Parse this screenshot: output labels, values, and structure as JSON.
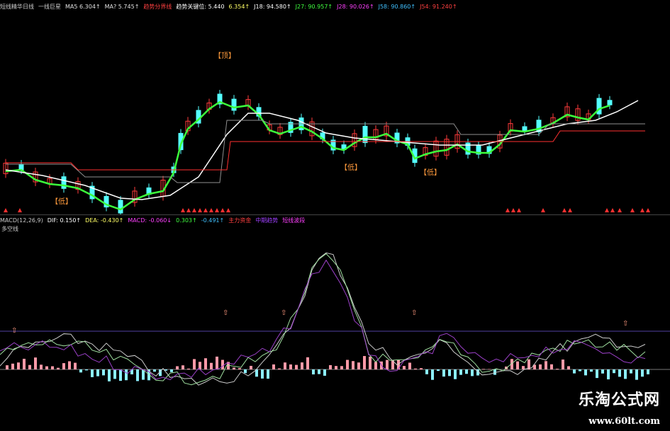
{
  "upper_header": [
    {
      "text": "短线精华日线",
      "color": "#cccccc"
    },
    {
      "text": "一线巨星",
      "color": "#cccccc"
    },
    {
      "text": "MA5 6.304↑",
      "color": "#e0e0e0"
    },
    {
      "text": "MA? 5.745↑",
      "color": "#e0e0e0"
    },
    {
      "text": "趋势分界线",
      "color": "#ff4040"
    },
    {
      "text": "趋势关键位: 5.440",
      "color": "#ffffff"
    },
    {
      "text": "6.354↑",
      "color": "#ffff66"
    },
    {
      "text": "J18: 94.580↑",
      "color": "#ffffff"
    },
    {
      "text": "J27: 90.957↑",
      "color": "#40ff40"
    },
    {
      "text": "J28: 90.026↑",
      "color": "#ff40ff"
    },
    {
      "text": "J58: 90.860↑",
      "color": "#40c0ff"
    },
    {
      "text": "J54: 91.240↑",
      "color": "#ff4040"
    }
  ],
  "lower_header": [
    {
      "text": "MACD(12,26,9)",
      "color": "#cccccc"
    },
    {
      "text": "DIF: 0.150↑",
      "color": "#ffffff"
    },
    {
      "text": "DEA: -0.430↑",
      "color": "#ffff66"
    },
    {
      "text": "MACD: -0.060↓",
      "color": "#ff40ff"
    },
    {
      "text": "0.303↑",
      "color": "#40ff40"
    },
    {
      "text": "-0.491↑",
      "color": "#40c0ff"
    },
    {
      "text": "主力资金",
      "color": "#ff4040"
    },
    {
      "text": "中期趋势",
      "color": "#a040ff"
    },
    {
      "text": "短线波段",
      "color": "#ff40ff"
    }
  ],
  "lower_title": "多空线",
  "tags": [
    {
      "text": "【顶】",
      "color": "#ff9a3c"
    },
    {
      "text": "【低】",
      "color": "#ff9a3c"
    },
    {
      "text": "【低】",
      "color": "#ff9a3c"
    },
    {
      "text": "【低】",
      "color": "#ff9a3c"
    }
  ],
  "watermark": {
    "cn": "乐淘公式网",
    "url": "www.60lt.com"
  },
  "colors": {
    "up": "#ff3b3b",
    "down": "#54ffff",
    "white": "#ffffff",
    "green": "#3cff3c",
    "red": "#ff3030",
    "gray": "#909090",
    "macd_pos": "#ff9aa8",
    "macd_neg": "#8cf0ff",
    "purple": "#9b40c8"
  }
}
